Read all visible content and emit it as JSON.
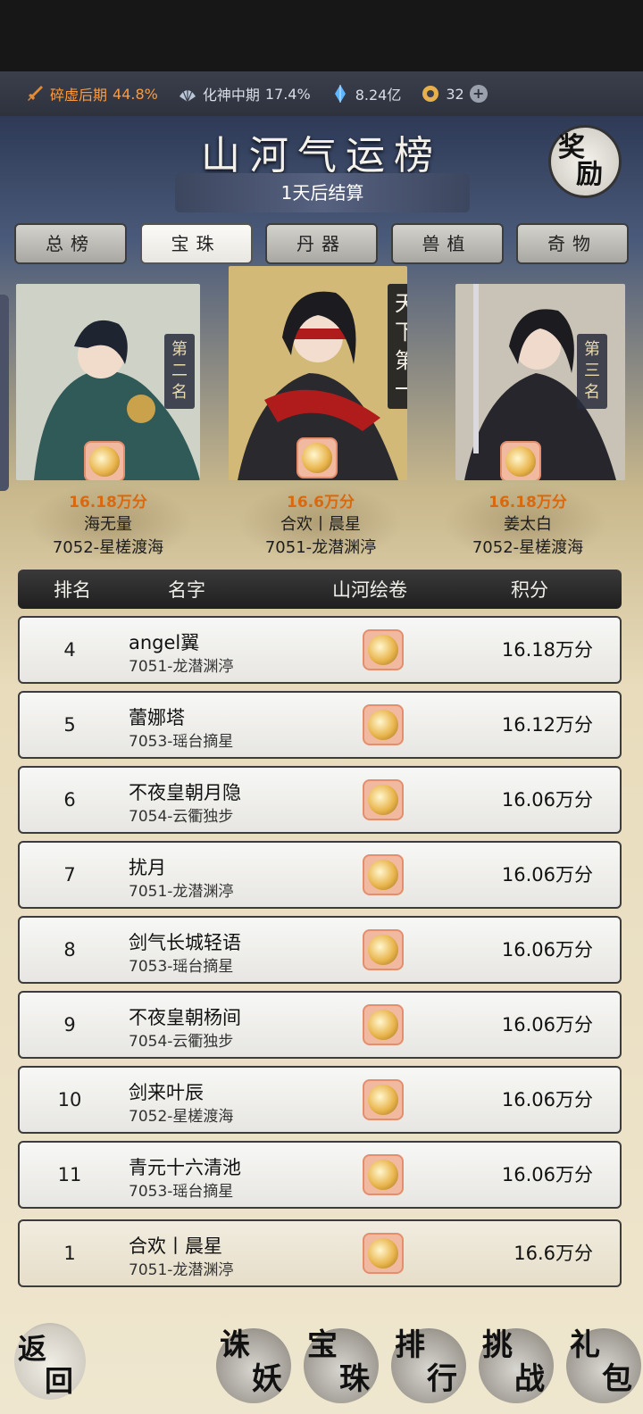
{
  "resources": {
    "realm1": {
      "name": "碎虚后期",
      "value": "44.8%",
      "icon": "sword-icon"
    },
    "realm2": {
      "name": "化神中期",
      "value": "17.4%",
      "icon": "fan-icon"
    },
    "spirit_stone": {
      "value": "8.24亿",
      "icon": "crystal-icon"
    },
    "currency": {
      "value": "32",
      "icon": "jade-coin-icon"
    }
  },
  "header": {
    "title": "山河气运榜",
    "reward_char1": "奖",
    "reward_char2": "励",
    "countdown": "1天后结算"
  },
  "tabs": [
    {
      "label": "总榜",
      "active": false
    },
    {
      "label": "宝珠",
      "active": true
    },
    {
      "label": "丹器",
      "active": false
    },
    {
      "label": "兽植",
      "active": false
    },
    {
      "label": "奇物",
      "active": false
    }
  ],
  "podium": {
    "second": {
      "tag": "第二名",
      "score": "16.18万分",
      "name": "海无量",
      "server": "7052-星槎渡海"
    },
    "first": {
      "tag": "天下第一",
      "score": "16.6万分",
      "name": "合欢丨晨星",
      "server": "7051-龙潜渊渟"
    },
    "third": {
      "tag": "第三名",
      "score": "16.18万分",
      "name": "姜太白",
      "server": "7052-星槎渡海"
    }
  },
  "table": {
    "headers": {
      "rank": "排名",
      "name": "名字",
      "scroll": "山河绘卷",
      "score": "积分"
    },
    "rows": [
      {
        "rank": "4",
        "name": "angel翼",
        "server": "7051-龙潜渊渟",
        "score": "16.18万分"
      },
      {
        "rank": "5",
        "name": "蕾娜塔",
        "server": "7053-瑶台摘星",
        "score": "16.12万分"
      },
      {
        "rank": "6",
        "name": "不夜皇朝月隐",
        "server": "7054-云衢独步",
        "score": "16.06万分"
      },
      {
        "rank": "7",
        "name": "扰月",
        "server": "7051-龙潜渊渟",
        "score": "16.06万分"
      },
      {
        "rank": "8",
        "name": "剑气长城轻语",
        "server": "7053-瑶台摘星",
        "score": "16.06万分"
      },
      {
        "rank": "9",
        "name": "不夜皇朝杨间",
        "server": "7054-云衢独步",
        "score": "16.06万分"
      },
      {
        "rank": "10",
        "name": "剑来叶辰",
        "server": "7052-星槎渡海",
        "score": "16.06万分"
      },
      {
        "rank": "11",
        "name": "青元十六清池",
        "server": "7053-瑶台摘星",
        "score": "16.06万分"
      }
    ],
    "my_row": {
      "rank": "1",
      "name": "合欢丨晨星",
      "server": "7051-龙潜渊渟",
      "score": "16.6万分"
    }
  },
  "bottom_nav": {
    "back": {
      "c1": "返",
      "c2": "回"
    },
    "items": [
      {
        "c1": "诛",
        "c2": "妖"
      },
      {
        "c1": "宝",
        "c2": "珠"
      },
      {
        "c1": "排",
        "c2": "行"
      },
      {
        "c1": "挑",
        "c2": "战"
      },
      {
        "c1": "礼",
        "c2": "包"
      }
    ]
  }
}
